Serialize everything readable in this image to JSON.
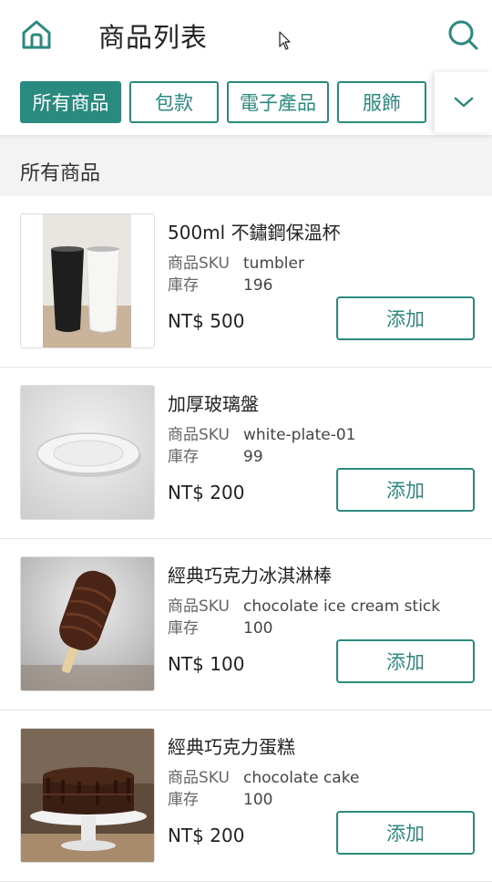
{
  "header": {
    "title": "商品列表",
    "home_icon": "home-icon",
    "search_icon": "search-icon"
  },
  "colors": {
    "accent": "#2a8a7f",
    "section_bg": "#f3f3f3"
  },
  "tabs": [
    {
      "label": "所有商品",
      "active": true
    },
    {
      "label": "包款",
      "active": false
    },
    {
      "label": "電子產品",
      "active": false
    },
    {
      "label": "服飾",
      "active": false
    }
  ],
  "section": {
    "title": "所有商品"
  },
  "labels": {
    "sku": "商品SKU",
    "stock": "庫存",
    "add": "添加"
  },
  "products": [
    {
      "name": "500ml 不鏽鋼保溫杯",
      "sku": "tumbler",
      "stock": "196",
      "price": "NT$ 500",
      "image": "tumbler-image"
    },
    {
      "name": "加厚玻璃盤",
      "sku": "white-plate-01",
      "stock": "99",
      "price": "NT$ 200",
      "image": "plate-image"
    },
    {
      "name": "經典巧克力冰淇淋棒",
      "sku": "chocolate ice cream stick",
      "stock": "100",
      "price": "NT$ 100",
      "image": "ice-cream-image"
    },
    {
      "name": "經典巧克力蛋糕",
      "sku": "chocolate cake",
      "stock": "100",
      "price": "NT$ 200",
      "image": "cake-image"
    }
  ]
}
